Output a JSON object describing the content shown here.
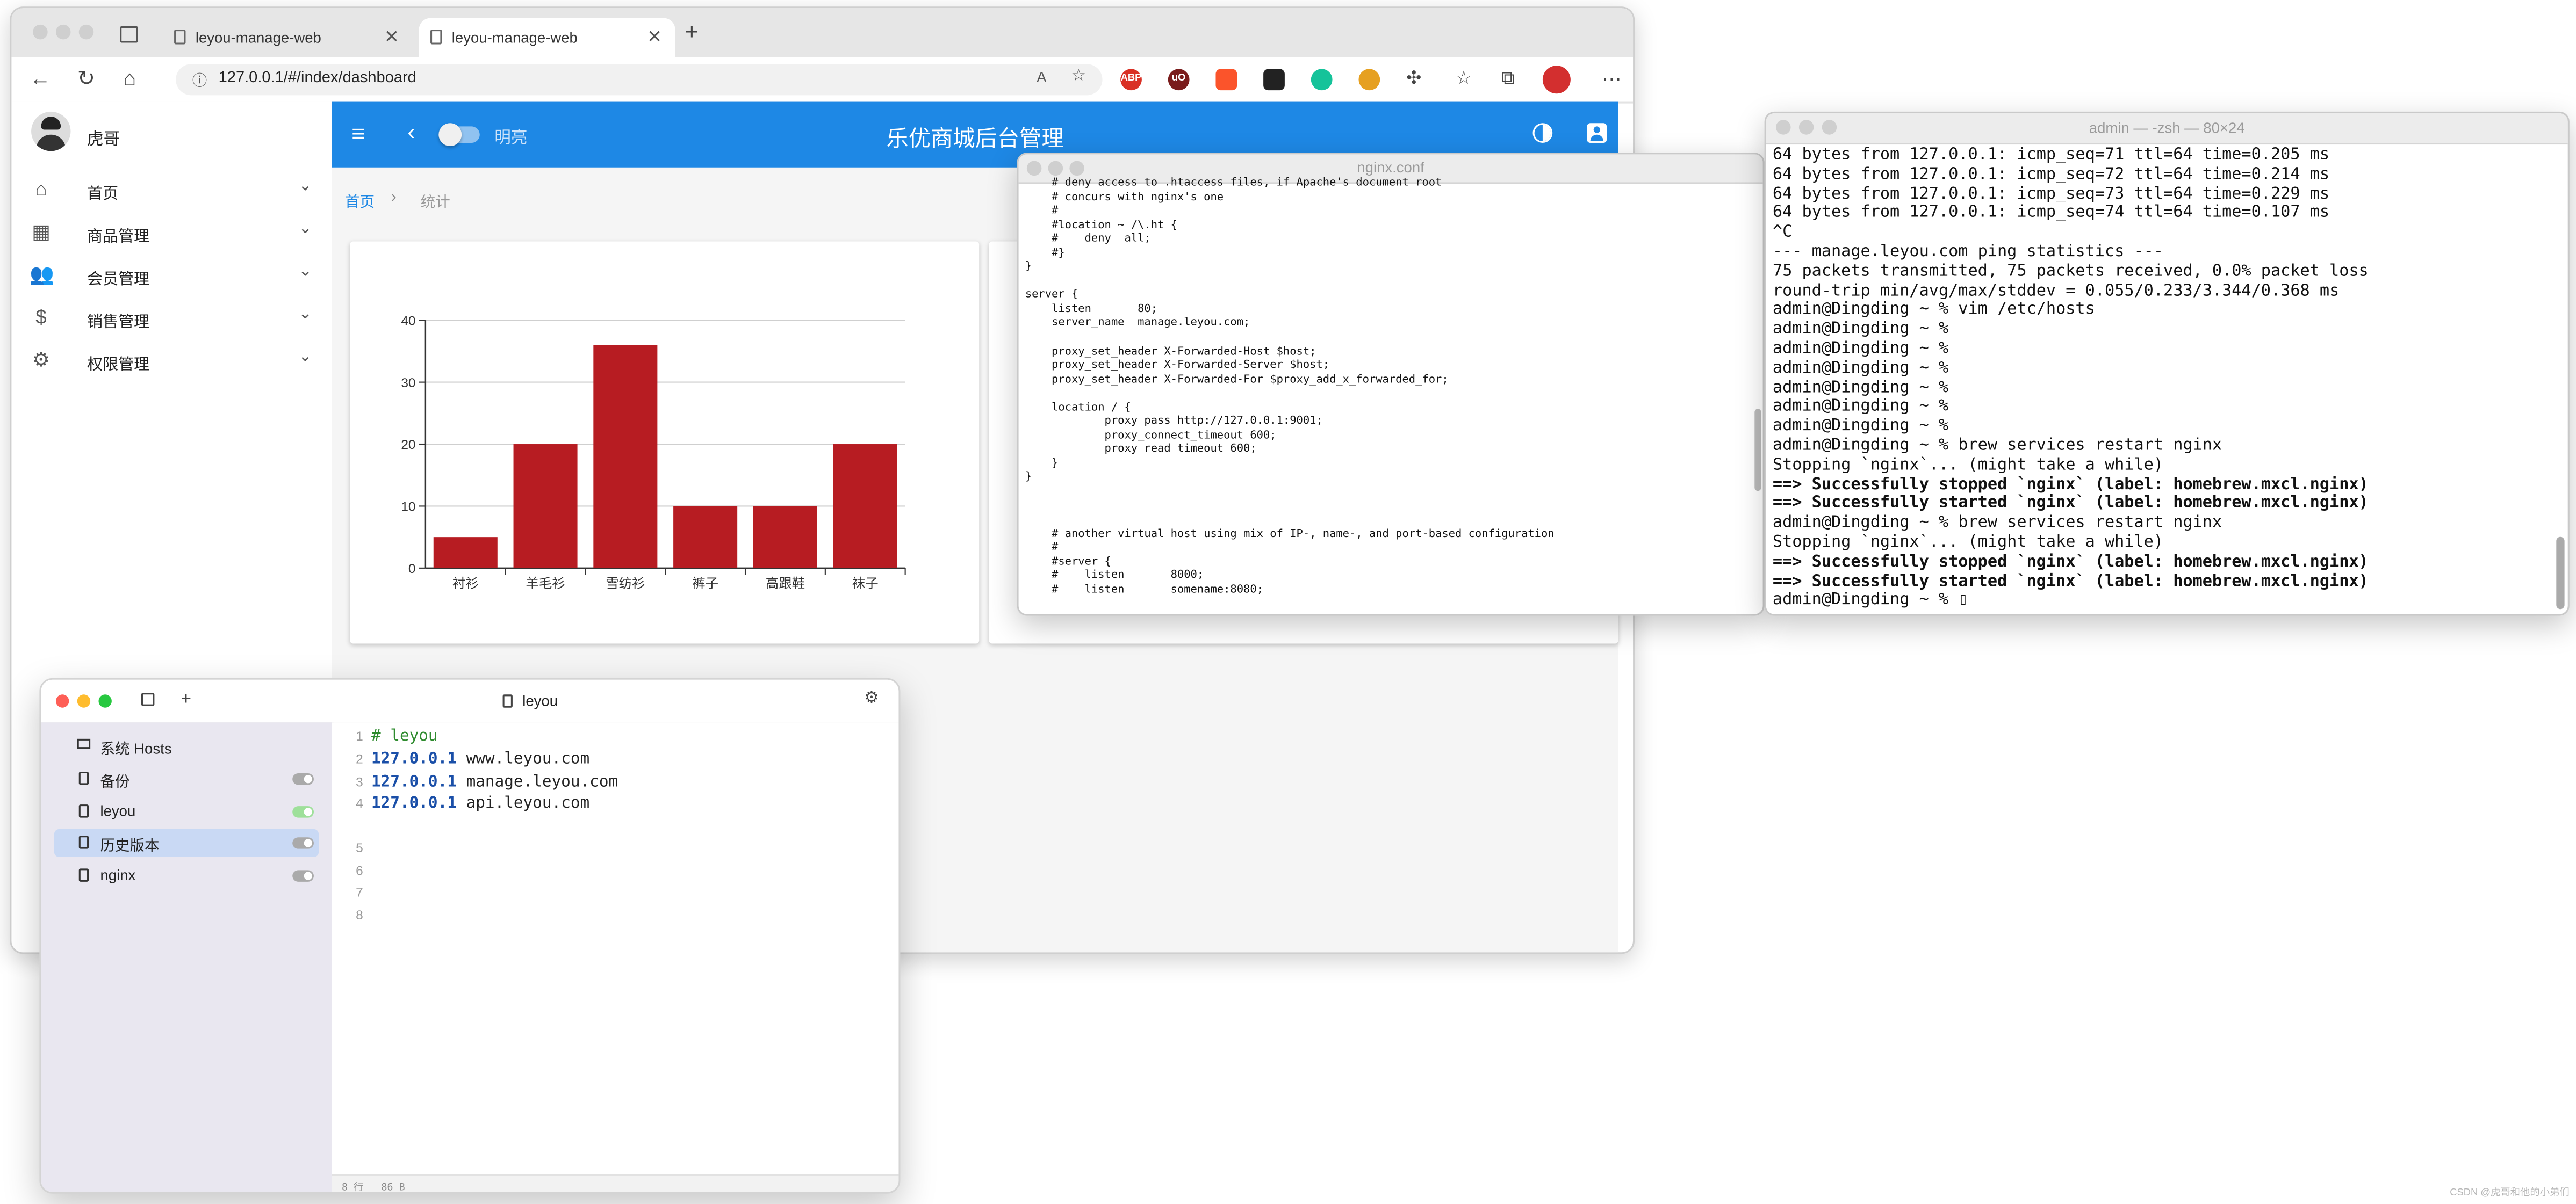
{
  "browser": {
    "tabs": [
      {
        "title": "leyou-manage-web",
        "close": "✕"
      },
      {
        "title": "leyou-manage-web",
        "close": "✕"
      }
    ],
    "new_tab": "+",
    "url": "127.0.0.1/#/index/dashboard",
    "extensions": [
      "ABP",
      "uO"
    ]
  },
  "app": {
    "user_name": "虎哥",
    "menu": [
      {
        "label": "首页",
        "icon": "home-icon"
      },
      {
        "label": "商品管理",
        "icon": "apps-icon"
      },
      {
        "label": "会员管理",
        "icon": "people-icon"
      },
      {
        "label": "销售管理",
        "icon": "dollar-icon"
      },
      {
        "label": "权限管理",
        "icon": "gear-icon"
      }
    ],
    "header_title": "乐优商城后台管理",
    "theme_toggle_label": "明亮",
    "breadcrumb": [
      "首页",
      "统计"
    ],
    "breadcrumb_sep": "›",
    "accent_color": "#1e88e5"
  },
  "chart_data": {
    "type": "bar",
    "categories": [
      "衬衫",
      "羊毛衫",
      "雪纺衫",
      "裤子",
      "高跟鞋",
      "袜子"
    ],
    "values": [
      5,
      20,
      36,
      10,
      10,
      20
    ],
    "ylim": [
      0,
      40
    ],
    "yticks": [
      "0",
      "10",
      "20",
      "30",
      "40"
    ],
    "grid": true,
    "color": "#b71c22"
  },
  "nginx": {
    "title": "nginx.conf",
    "text": "    # deny access to .htaccess files, if Apache's document root\n    # concurs with nginx's one\n    #\n    #location ~ /\\.ht {\n    #    deny  all;\n    #}\n}\n\nserver {\n    listen       80;\n    server_name  manage.leyou.com;\n\n    proxy_set_header X-Forwarded-Host $host;\n    proxy_set_header X-Forwarded-Server $host;\n    proxy_set_header X-Forwarded-For $proxy_add_x_forwarded_for;\n\n    location / {\n            proxy_pass http://127.0.0.1:9001;\n            proxy_connect_timeout 600;\n            proxy_read_timeout 600;\n    }\n}\n\n\n\n    # another virtual host using mix of IP-, name-, and port-based configuration\n    #\n    #server {\n    #    listen       8000;\n    #    listen       somename:8080;"
  },
  "terminal": {
    "title": "admin — -zsh — 80×24",
    "lines": [
      {
        "text": "64 bytes from 127.0.0.1: icmp_seq=71 ttl=64 time=0.205 ms",
        "bold": false
      },
      {
        "text": "64 bytes from 127.0.0.1: icmp_seq=72 ttl=64 time=0.214 ms",
        "bold": false
      },
      {
        "text": "64 bytes from 127.0.0.1: icmp_seq=73 ttl=64 time=0.229 ms",
        "bold": false
      },
      {
        "text": "64 bytes from 127.0.0.1: icmp_seq=74 ttl=64 time=0.107 ms",
        "bold": false
      },
      {
        "text": "^C",
        "bold": false
      },
      {
        "text": "--- manage.leyou.com ping statistics ---",
        "bold": false
      },
      {
        "text": "75 packets transmitted, 75 packets received, 0.0% packet loss",
        "bold": false
      },
      {
        "text": "round-trip min/avg/max/stddev = 0.055/0.233/3.344/0.368 ms",
        "bold": false
      },
      {
        "text": "admin@Dingding ~ % vim /etc/hosts",
        "bold": false
      },
      {
        "text": "admin@Dingding ~ %",
        "bold": false
      },
      {
        "text": "admin@Dingding ~ %",
        "bold": false
      },
      {
        "text": "admin@Dingding ~ %",
        "bold": false
      },
      {
        "text": "admin@Dingding ~ %",
        "bold": false
      },
      {
        "text": "admin@Dingding ~ %",
        "bold": false
      },
      {
        "text": "admin@Dingding ~ %",
        "bold": false
      },
      {
        "text": "admin@Dingding ~ % brew services restart nginx",
        "bold": false
      },
      {
        "text": "Stopping `nginx`... (might take a while)",
        "bold": false
      },
      {
        "text": "==> Successfully stopped `nginx` (label: homebrew.mxcl.nginx)",
        "bold": true
      },
      {
        "text": "==> Successfully started `nginx` (label: homebrew.mxcl.nginx)",
        "bold": true
      },
      {
        "text": "admin@Dingding ~ % brew services restart nginx",
        "bold": false
      },
      {
        "text": "Stopping `nginx`... (might take a while)",
        "bold": false
      },
      {
        "text": "==> Successfully stopped `nginx` (label: homebrew.mxcl.nginx)",
        "bold": true
      },
      {
        "text": "==> Successfully started `nginx` (label: homebrew.mxcl.nginx)",
        "bold": true
      },
      {
        "text": "admin@Dingding ~ % ▯",
        "bold": false
      }
    ]
  },
  "hosts": {
    "title": "leyou",
    "add": "+",
    "items": [
      {
        "label": "系统 Hosts",
        "toggle": null
      },
      {
        "label": "备份",
        "toggle": "off"
      },
      {
        "label": "leyou",
        "toggle": "on"
      },
      {
        "label": "历史版本",
        "toggle": "off"
      },
      {
        "label": "nginx",
        "toggle": "off"
      }
    ],
    "line_numbers": [
      "1",
      "2",
      "3",
      "4",
      "5",
      "6",
      "7",
      "8"
    ],
    "lines": [
      {
        "comment": "# leyou"
      },
      {
        "ip": "127.0.0.1",
        "host": "www.leyou.com"
      },
      {
        "ip": "127.0.0.1",
        "host": "manage.leyou.com"
      },
      {
        "ip": "127.0.0.1",
        "host": "api.leyou.com"
      }
    ],
    "status": "8 行   86 B"
  },
  "watermark": "CSDN @虎哥和他的小弟们"
}
